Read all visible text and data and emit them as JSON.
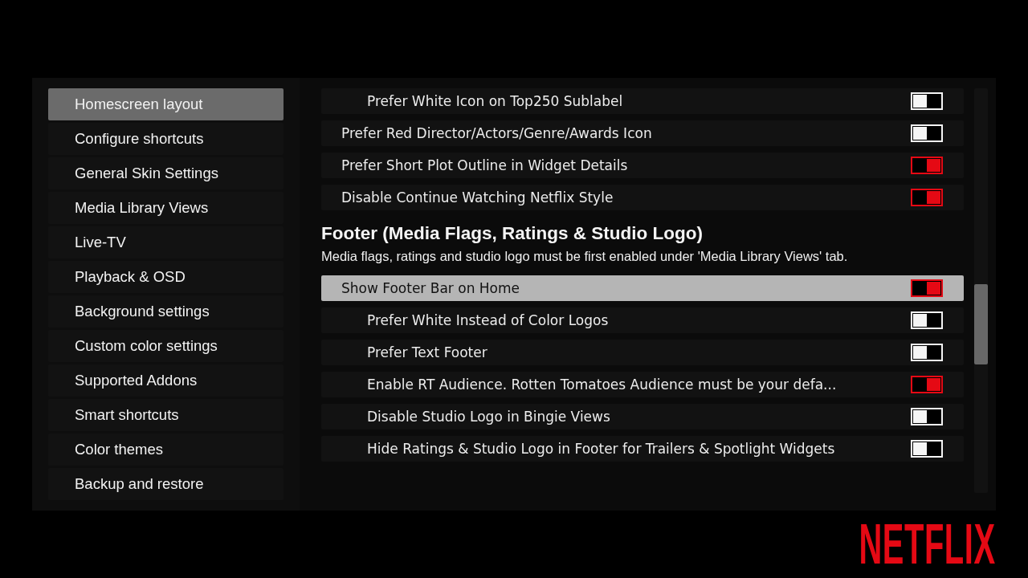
{
  "sidebar": {
    "items": [
      {
        "label": "Homescreen layout",
        "selected": true
      },
      {
        "label": "Configure shortcuts",
        "selected": false
      },
      {
        "label": "General Skin Settings",
        "selected": false
      },
      {
        "label": "Media Library Views",
        "selected": false
      },
      {
        "label": "Live-TV",
        "selected": false
      },
      {
        "label": "Playback & OSD",
        "selected": false
      },
      {
        "label": "Background settings",
        "selected": false
      },
      {
        "label": "Custom color settings",
        "selected": false
      },
      {
        "label": "Supported Addons",
        "selected": false
      },
      {
        "label": "Smart shortcuts",
        "selected": false
      },
      {
        "label": "Color themes",
        "selected": false
      },
      {
        "label": "Backup and restore",
        "selected": false
      }
    ]
  },
  "content": {
    "groups": [
      {
        "items": [
          {
            "children": [
              {
                "label": "Prefer White Icon on Top250 Sublabel",
                "on": false,
                "selected": false
              }
            ]
          },
          {
            "label": "Prefer Red Director/Actors/Genre/Awards Icon",
            "on": false,
            "selected": false
          },
          {
            "label": "Prefer Short Plot Outline in Widget Details",
            "on": true,
            "selected": false
          },
          {
            "label": "Disable Continue Watching Netflix Style",
            "on": true,
            "selected": false
          }
        ]
      },
      {
        "heading": "Footer (Media Flags, Ratings & Studio Logo)",
        "description": "Media flags, ratings and studio logo must be first enabled under 'Media Library Views' tab.",
        "items": [
          {
            "label": "Show Footer Bar on Home",
            "on": true,
            "selected": true,
            "children": [
              {
                "label": "Prefer White Instead of Color Logos",
                "on": false,
                "selected": false
              },
              {
                "label": "Prefer Text Footer",
                "on": false,
                "selected": false
              },
              {
                "label": "Enable RT Audience. Rotten Tomatoes Audience must be your defa...",
                "on": true,
                "selected": false
              },
              {
                "label": "Disable Studio Logo in Bingie Views",
                "on": false,
                "selected": false
              },
              {
                "label": "Hide Ratings & Studio Logo in Footer for Trailers & Spotlight Widgets",
                "on": false,
                "selected": false
              }
            ]
          }
        ]
      }
    ]
  },
  "logo": {
    "text": "NETFLIX"
  }
}
